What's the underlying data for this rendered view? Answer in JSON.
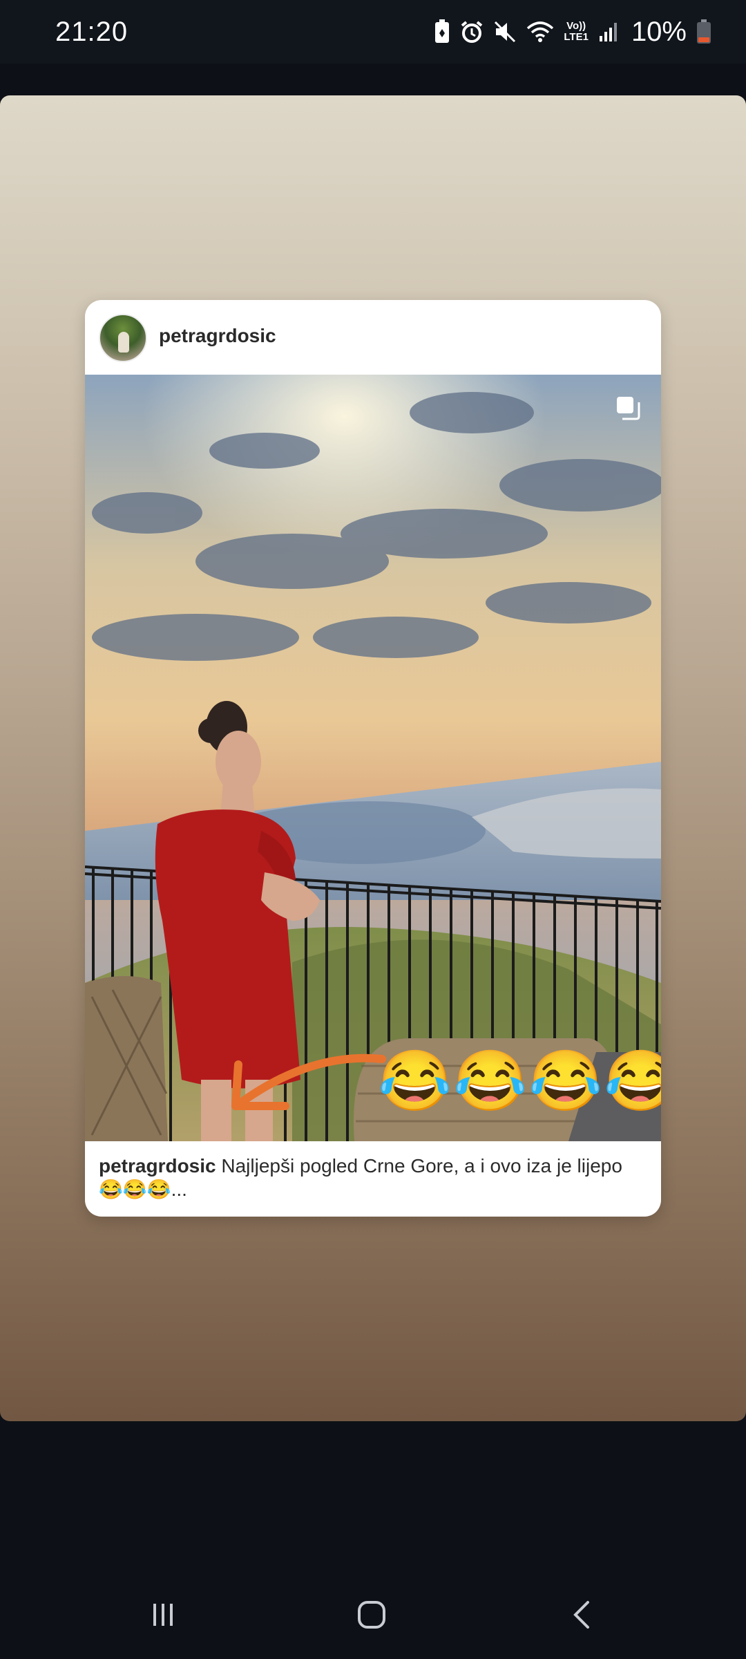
{
  "status_bar": {
    "time": "21:20",
    "lte_label_top": "Vo))",
    "lte_label_bottom": "LTE1",
    "battery_percent": "10%",
    "icons": [
      "battery-saver-icon",
      "alarm-icon",
      "mute-icon",
      "wifi-icon",
      "volte-icon",
      "signal-icon",
      "battery-icon"
    ]
  },
  "post": {
    "username": "petragrdosic",
    "photo_overlay_emojis": [
      "😂",
      "😂",
      "😂",
      "😂"
    ],
    "caption_username": "petragrdosic",
    "caption_text": "Najljepši pogled Crne Gore, a i ovo iza je lijepo😂😂😂...",
    "icons": [
      "multiple-photos-icon",
      "arrow-icon"
    ]
  },
  "nav_bar": {
    "icons": [
      "recent-apps-icon",
      "home-icon",
      "back-icon"
    ]
  },
  "colors": {
    "status_bar_bg": "#11151c",
    "page_bg": "#0d1016",
    "arrow": "#e8732e",
    "dress": "#b31b1b"
  }
}
